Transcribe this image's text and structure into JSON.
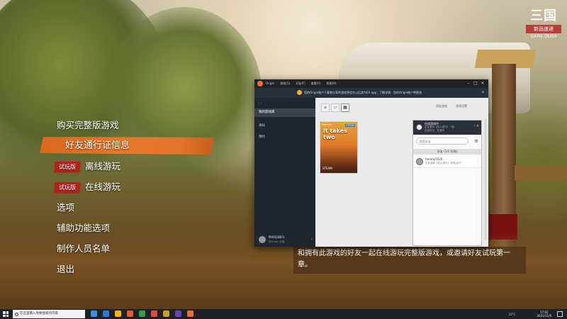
{
  "watermark": {
    "logo": "三国",
    "sub": "新品速递",
    "sub2": "GAME.DUBA"
  },
  "menu": {
    "items": [
      {
        "label": "购买完整版游戏"
      },
      {
        "label": "好友通行证信息",
        "selected": true
      },
      {
        "badge": "试玩版",
        "label": "离线游玩"
      },
      {
        "badge": "试玩版",
        "label": "在线游玩"
      },
      {
        "label": "选项"
      },
      {
        "label": "辅助功能选项"
      },
      {
        "label": "制作人员名单"
      },
      {
        "label": "退出"
      }
    ]
  },
  "subtitle": "和拥有此游戏的好友一起在线游玩完整版游戏，或邀请好友试玩第一章。",
  "origin": {
    "menus": [
      "Origin",
      "游戏(G)",
      "好友(F)",
      "查看(V)",
      "帮助(H)"
    ],
    "banner": "您的Origin账户下载和分享的游戏将会在以后改为EA app；了解详情 · 您的Origin账户将更改",
    "sidebar": {
      "nav": "‹  ›",
      "active": "我的游戏库",
      "items": [
        "通知",
        "预约"
      ],
      "user": {
        "name": "MX6Q3B01",
        "status": "在Origin 在线"
      }
    },
    "tools": [
      "添加游戏",
      "游戏设置"
    ],
    "game": {
      "title": "it takes two",
      "brand": "Friend's",
      "tag": "STEAM",
      "platform": "STEAM"
    },
    "friends": {
      "header": {
        "name": "在线游戏中",
        "status": "正在游玩《双人成行》一起",
        "sub": "在线可见 · 在游戏"
      },
      "search_placeholder": "搜索好友",
      "group": "好友 (1/1 在线)",
      "friend": {
        "name": "tommy7020",
        "status": "正在游玩《双人成行》· 在线·大厅"
      }
    }
  },
  "taskbar": {
    "search_placeholder": "在这里输入你要搜索的内容",
    "temp": "23°C",
    "time": "17:02",
    "date": "2021/11/6",
    "app_colors": [
      "#3c8ee0",
      "#2b7bd3",
      "#f4b400",
      "#e35b2a",
      "#2e9e4f",
      "#e04a3a",
      "#c9a01e",
      "#6a3fb5",
      "#f56c2d"
    ]
  }
}
